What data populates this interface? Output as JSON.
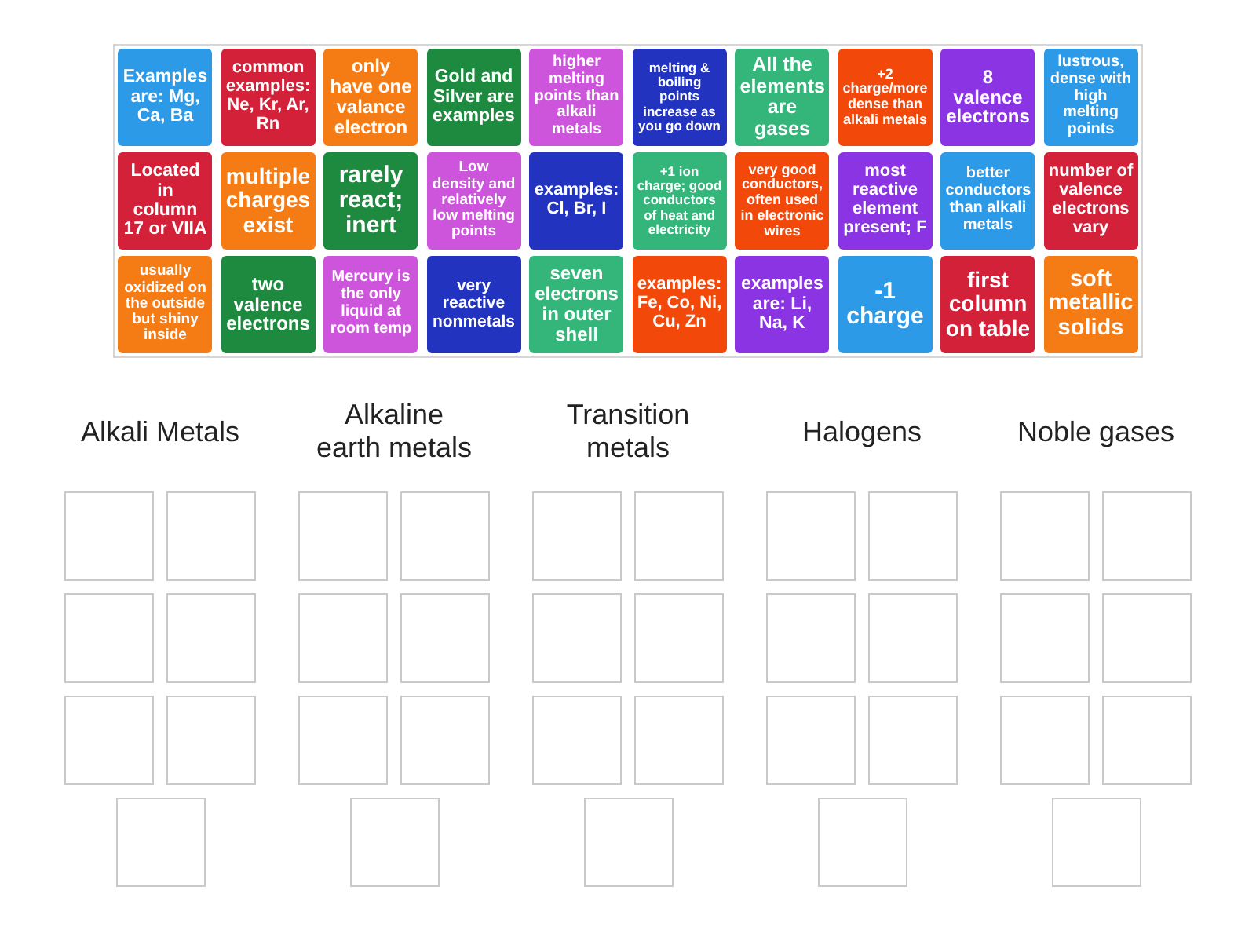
{
  "tiles": [
    {
      "text": "Examples are: Mg, Ca, Ba",
      "color": "#2d9ae8"
    },
    {
      "text": "common examples: Ne, Kr, Ar, Rn",
      "color": "#d4213a"
    },
    {
      "text": "only have one valance electron",
      "color": "#f57c14"
    },
    {
      "text": "Gold and Silver are examples",
      "color": "#1d8a40"
    },
    {
      "text": "higher melting points than alkali metals",
      "color": "#cd55dc"
    },
    {
      "text": "melting & boiling points increase as you go down",
      "color": "#2233bf"
    },
    {
      "text": "All the elements are gases",
      "color": "#34b67b"
    },
    {
      "text": "+2 charge/more dense than alkali metals",
      "color": "#f2490b"
    },
    {
      "text": "8 valence electrons",
      "color": "#8b34e4"
    },
    {
      "text": "lustrous, dense with high melting points",
      "color": "#2d9ae8"
    },
    {
      "text": "Located in column 17 or VIIA",
      "color": "#d4213a"
    },
    {
      "text": "multiple charges exist",
      "color": "#f57c14"
    },
    {
      "text": "rarely react; inert",
      "color": "#1d8a40"
    },
    {
      "text": "Low density and relatively low melting points",
      "color": "#cd55dc"
    },
    {
      "text": "examples: Cl, Br, I",
      "color": "#2233bf"
    },
    {
      "text": "+1 ion charge; good conductors of heat and electricity",
      "color": "#34b67b"
    },
    {
      "text": "very good conductors, often used in electronic wires",
      "color": "#f2490b"
    },
    {
      "text": "most reactive element present; F",
      "color": "#8b34e4"
    },
    {
      "text": "better conductors than alkali metals",
      "color": "#2d9ae8"
    },
    {
      "text": "number of valence electrons vary",
      "color": "#d4213a"
    },
    {
      "text": "usually oxidized on the outside but shiny inside",
      "color": "#f57c14"
    },
    {
      "text": "two valence electrons",
      "color": "#1d8a40"
    },
    {
      "text": "Mercury is the only liquid at room temp",
      "color": "#cd55dc"
    },
    {
      "text": "very reactive nonmetals",
      "color": "#2233bf"
    },
    {
      "text": "seven electrons in outer shell",
      "color": "#34b67b"
    },
    {
      "text": "examples: Fe, Co, Ni, Cu, Zn",
      "color": "#f2490b"
    },
    {
      "text": "examples are: Li, Na, K",
      "color": "#8b34e4"
    },
    {
      "text": "-1 charge",
      "color": "#2d9ae8"
    },
    {
      "text": "first column on table",
      "color": "#d4213a"
    },
    {
      "text": "soft metallic solids",
      "color": "#f57c14"
    }
  ],
  "groups": [
    {
      "title": "Alkali Metals",
      "slots": [
        {
          "empty": true
        },
        {
          "empty": true
        },
        {
          "empty": true
        },
        {
          "empty": true
        },
        {
          "empty": true
        },
        {
          "empty": true
        },
        {
          "empty": true
        }
      ]
    },
    {
      "title": "Alkaline earth metals",
      "slots": [
        {
          "empty": true
        },
        {
          "empty": true
        },
        {
          "empty": true
        },
        {
          "empty": true
        },
        {
          "empty": true
        },
        {
          "empty": true
        },
        {
          "empty": true
        }
      ]
    },
    {
      "title": "Transition metals",
      "slots": [
        {
          "empty": true
        },
        {
          "empty": true
        },
        {
          "empty": true
        },
        {
          "empty": true
        },
        {
          "empty": true
        },
        {
          "empty": true
        },
        {
          "empty": true
        }
      ]
    },
    {
      "title": "Halogens",
      "slots": [
        {
          "empty": true
        },
        {
          "empty": true
        },
        {
          "empty": true
        },
        {
          "empty": true
        },
        {
          "empty": true
        },
        {
          "empty": true
        },
        {
          "empty": true
        }
      ]
    },
    {
      "title": "Noble gases",
      "slots": [
        {
          "empty": true
        },
        {
          "empty": true
        },
        {
          "empty": true
        },
        {
          "empty": true
        },
        {
          "empty": true
        },
        {
          "empty": true
        },
        {
          "empty": true
        }
      ]
    }
  ]
}
